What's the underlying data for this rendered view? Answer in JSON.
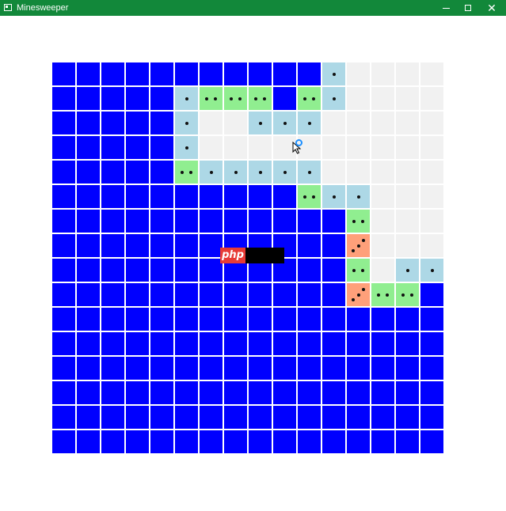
{
  "window": {
    "title": "Minesweeper",
    "controls": {
      "minimize": "minimize",
      "maximize": "maximize",
      "close": "✕"
    },
    "titlebar_color": "#12883a"
  },
  "board": {
    "rows": 16,
    "cols": 16,
    "legend": {
      "H": "hidden",
      "E": "revealed-empty",
      "1": "one",
      "2": "two",
      "3": "three"
    },
    "colors": {
      "hidden": "#0000ff",
      "empty": "#f1f1f1",
      "one": "#add8e6",
      "two": "#90ee90",
      "three": "#ffa07a"
    },
    "grid": [
      "HHHHHHHHHHHEEEEE",
      "HHHHH1222H21EEEE",
      "HHHHH1EE111EEEEE",
      "HHHHH1EEEEEEEEEE",
      "HHHHH211111EEEEE",
      "HHHHHHHHHH211EEE",
      "HHHHHHHHHHHH2EEE",
      "HHHHHHHHHHHH3EEE",
      "HHHHHHHHHHHH2E11",
      "HHHHHHHHHHHH322H",
      "HHHHHHHHHHHHHHHH",
      "HHHHHHHHHHHHHHHH",
      "HHHHHHHHHHHHHHHH",
      "HHHHHHHHHHHHHHHH",
      "HHHHHHHHHHHHHHHH",
      "HHHHHHHHHHHHHHHH"
    ],
    "first_row_override": {
      "11": "1"
    }
  },
  "overlay": {
    "badge_text": "php",
    "badge_color": "#e73b36"
  },
  "pointer": {
    "cursor_icon": "arrow-cursor-icon",
    "busy_icon": "busy-spinner-icon"
  }
}
